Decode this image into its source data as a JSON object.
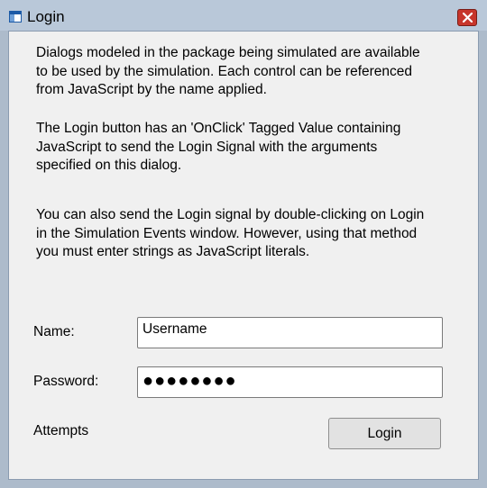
{
  "window": {
    "title": "Login"
  },
  "description": {
    "para1": "Dialogs modeled in the package being simulated are available\nto be used by the simulation. Each control can be referenced\nfrom JavaScript by the name applied.",
    "para2": "The Login button has an 'OnClick' Tagged Value containing\nJavaScript to send the Login Signal with the arguments\nspecified on this dialog.",
    "para3": "You can also send the Login signal by double-clicking on Login\nin the Simulation Events window. However, using that method\nyou must enter strings as JavaScript literals."
  },
  "form": {
    "name_label": "Name:",
    "name_value": "Username",
    "password_label": "Password:",
    "password_value": "●●●●●●●●",
    "attempts_label": "Attempts",
    "login_label": "Login"
  },
  "colors": {
    "titlebar": "#b9c8d9",
    "frame": "#adbbcb",
    "close_button": "#c7352b",
    "client_bg": "#f0f0f0"
  },
  "icons": [
    "window-icon",
    "close-icon"
  ]
}
